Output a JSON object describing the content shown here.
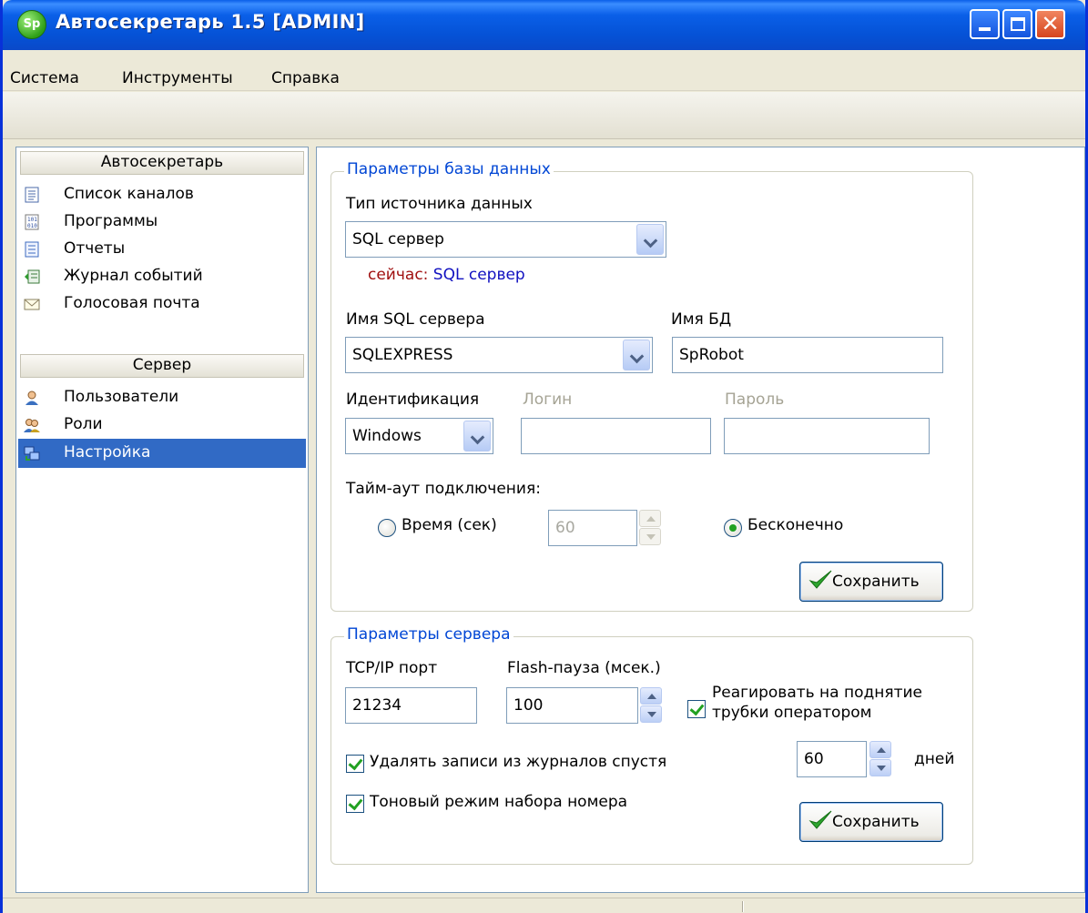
{
  "window": {
    "title": "Автосекретарь 1.5 [ADMIN]",
    "icon_text": "Sp"
  },
  "menu": [
    "Система",
    "Инструменты",
    "Справка"
  ],
  "nav": {
    "section1": {
      "header": "Автосекретарь",
      "items": [
        {
          "label": "Список каналов",
          "icon": "list-icon"
        },
        {
          "label": "Программы",
          "icon": "binary-file-icon"
        },
        {
          "label": "Отчеты",
          "icon": "report-icon"
        },
        {
          "label": "Журнал событий",
          "icon": "event-log-icon"
        },
        {
          "label": "Голосовая почта",
          "icon": "envelope-icon"
        }
      ]
    },
    "section2": {
      "header": "Сервер",
      "items": [
        {
          "label": "Пользователи",
          "icon": "user-icon"
        },
        {
          "label": "Роли",
          "icon": "users-group-icon"
        },
        {
          "label": "Настройка",
          "icon": "network-settings-icon",
          "selected": true
        }
      ]
    }
  },
  "db_params": {
    "group_title": "Параметры базы данных",
    "source_type_label": "Тип источника данных",
    "source_type_value": "SQL сервер",
    "current_prefix": "сейчас:",
    "current_value": "SQL сервер",
    "sql_server_label": "Имя SQL сервера",
    "sql_server_value": "SQLEXPRESS",
    "db_name_label": "Имя БД",
    "db_name_value": "SpRobot",
    "auth_label": "Идентификация",
    "auth_value": "Windows",
    "login_label": "Логин",
    "login_value": "",
    "password_label": "Пароль",
    "password_value": "",
    "timeout_label": "Тайм-аут подключения:",
    "time_option_label": "Время (сек)",
    "time_value": "60",
    "infinite_option_label": "Бесконечно",
    "selected_timeout": "Бесконечно",
    "save_label": "Сохранить"
  },
  "server_params": {
    "group_title": "Параметры сервера",
    "tcp_port_label": "TCP/IP порт",
    "tcp_port_value": "21234",
    "flash_pause_label": "Flash-пауза (мсек.)",
    "flash_pause_value": "100",
    "react_offhook_label_line1": "Реагировать на поднятие",
    "react_offhook_label_line2": "трубки оператором",
    "react_offhook_checked": true,
    "delete_logs_label": "Удалять записи из журналов спустя",
    "delete_logs_checked": true,
    "delete_logs_days_value": "60",
    "days_label": "дней",
    "tone_dial_label": "Тоновый режим набора номера",
    "tone_dial_checked": true,
    "save_label": "Сохранить"
  },
  "colors": {
    "title_bar": "#0a5fe8",
    "selection": "#316ac5",
    "group_title": "#0046d5",
    "current_prefix": "#a01010",
    "current_value": "#1010c0",
    "check_green": "#21a121"
  }
}
